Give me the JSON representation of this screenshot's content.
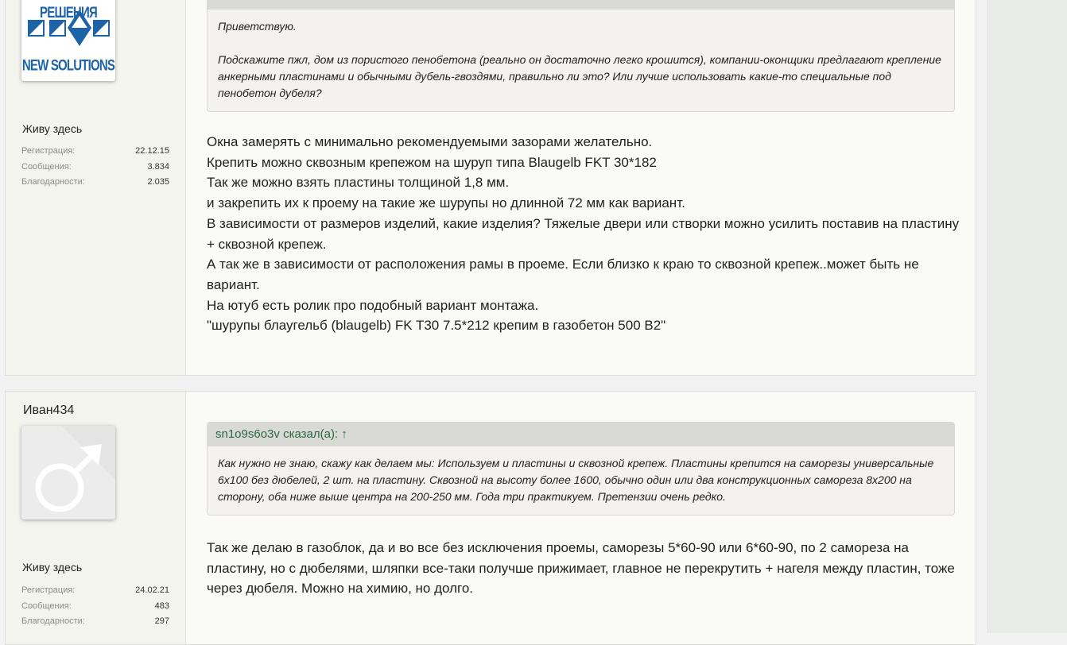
{
  "posts": [
    {
      "user": {
        "avatar_top_text": "НОВЫЕ РЕШЕНИЯ",
        "avatar_bottom_text": "NEW SOLUTIONS",
        "title": "Живу здесь",
        "stats": [
          {
            "label": "Регистрация:",
            "value": "22.12.15"
          },
          {
            "label": "Сообщения:",
            "value": "3.834"
          },
          {
            "label": "Благодарности:",
            "value": "2.035"
          }
        ]
      },
      "quote": {
        "lines": [
          "Приветствую.",
          "Подскажите пжл, дом из пористого пенобетона (реально он достаточно легко крошится), компании-оконщики предлагают крепление анкерными пластинами и обычными дубель-гвоздями, правильно ли это? Или лучше использовать какие-то специальные под пенобетон дубеля?"
        ]
      },
      "body": [
        "Окна замерять с минимально рекомендуемыми зазорами желательно.",
        "Крепить можно сквозным крепежом на шуруп типа Blaugelb FKT 30*182",
        "Так же можно взять пластины толщиной 1,8 мм.",
        "и закрепить их к проему на такие же шурупы но длинной 72 мм как вариант.",
        "В зависимости от размеров изделий, какие изделия? Тяжелые двери или створки можно усилить поставив на пластину + сквозной крепеж.",
        "А так же в зависимости от расположения рамы в проеме. Если близко к краю то сквозной крепеж..может быть не вариант.",
        "На ютуб есть ролик про подобный вариант монтажа.",
        "\"шурупы блаугельб (blaugelb) FK T30 7.5*212 крепим в газобетон 500 B2\""
      ]
    },
    {
      "user": {
        "name": "Иван434",
        "title": "Живу здесь",
        "stats": [
          {
            "label": "Регистрация:",
            "value": "24.02.21"
          },
          {
            "label": "Сообщения:",
            "value": "483"
          },
          {
            "label": "Благодарности:",
            "value": "297"
          }
        ]
      },
      "quote": {
        "author": "sn1o9s6o3v сказал(а): ↑",
        "text": "Как нужно не знаю, скажу как делаем мы: Используем и пластины и сквозной крепеж. Пластины крепится на саморезы универсальные 6х100 без дюбелей, 2 шт. на пластину. Сквозной на высоту более 1600, обычно один или два конструкционных самореза 8х200 на сторону, оба ниже выше центра на 200-250 мм. Года три практикуем. Претензии очень редко."
      },
      "body": [
        "Так же делаю в газоблок, да и во все без исключения проемы, саморезы 5*60-90 или 6*60-90, по 2 самореза на пластину, но с дюбелями, шляпки все-таки получше прижимает, главное не перекрутить + нагеля между пластин, тоже через дюбеля. Можно на химию, но долго."
      ]
    }
  ]
}
